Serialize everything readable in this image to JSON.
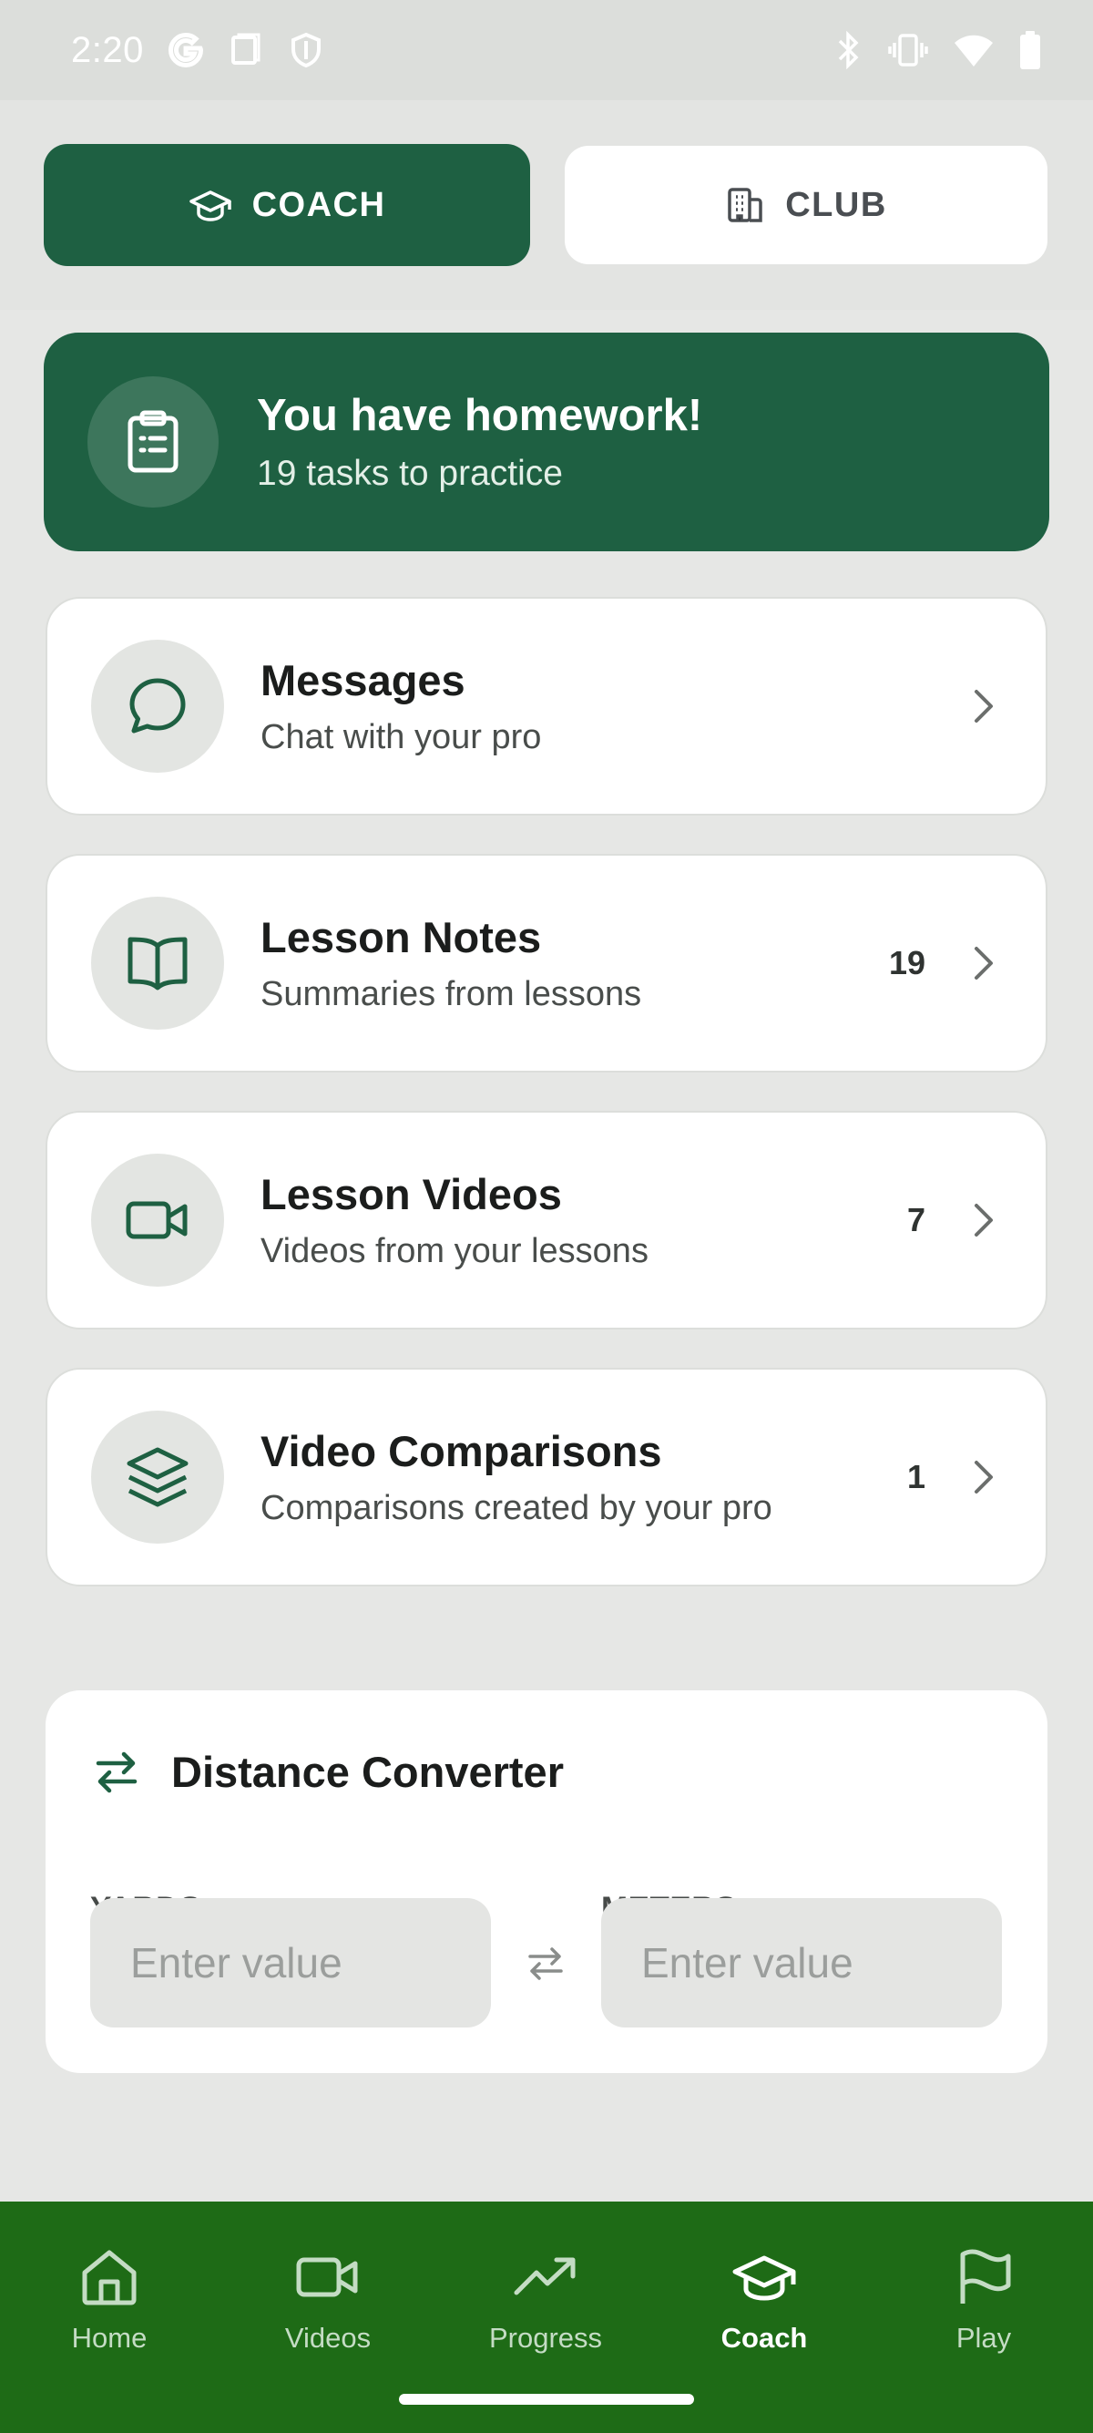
{
  "status_bar": {
    "time": "2:20",
    "left_icons": [
      "google-icon",
      "screen-icon",
      "shield-icon"
    ],
    "right_icons": [
      "bluetooth-icon",
      "vibrate-icon",
      "wifi-icon",
      "battery-icon"
    ]
  },
  "mode_toggle": {
    "coach_label": "COACH",
    "club_label": "CLUB",
    "selected": "COACH"
  },
  "homework": {
    "title": "You have homework!",
    "subtitle": "19 tasks to practice",
    "icon": "clipboard-icon"
  },
  "cards": [
    {
      "title": "Messages",
      "subtitle": "Chat with your pro",
      "count": "",
      "icon": "chat-bubble-icon"
    },
    {
      "title": "Lesson Notes",
      "subtitle": "Summaries from lessons",
      "count": "19",
      "icon": "book-icon"
    },
    {
      "title": "Lesson Videos",
      "subtitle": "Videos from your lessons",
      "count": "7",
      "icon": "video-camera-icon"
    },
    {
      "title": "Video Comparisons",
      "subtitle": "Comparisons created by your pro",
      "count": "1",
      "icon": "layers-icon"
    }
  ],
  "converter": {
    "title": "Distance Converter",
    "yards_label": "YARDS",
    "meters_label": "METERS",
    "yards_placeholder": "Enter value",
    "meters_placeholder": "Enter value",
    "yards_value": "",
    "meters_value": ""
  },
  "bottom_nav": {
    "items": [
      {
        "label": "Home",
        "icon": "home-icon"
      },
      {
        "label": "Videos",
        "icon": "video-camera-icon"
      },
      {
        "label": "Progress",
        "icon": "trending-up-icon"
      },
      {
        "label": "Coach",
        "icon": "graduation-cap-icon"
      },
      {
        "label": "Play",
        "icon": "flag-icon"
      }
    ],
    "active": "Coach"
  },
  "colors": {
    "brand_green": "#1e6042",
    "nav_green": "#1e6b16",
    "background": "#e6e7e5",
    "card": "#ffffff"
  }
}
